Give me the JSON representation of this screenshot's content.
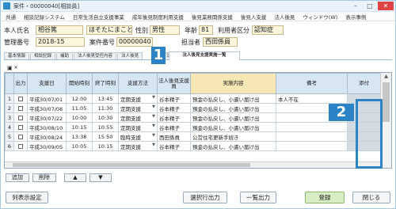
{
  "window": {
    "title": "案件・00000040[相談員]"
  },
  "menu": [
    "共通",
    "相談記録システム",
    "日常生活自立支援事業",
    "成年後見制度利用支援",
    "後見業務関係支援",
    "後見人支援",
    "法人後見",
    "ウィンドウ(W)",
    "表示事例"
  ],
  "info": {
    "name_label": "本人氏名",
    "name_value": "相谷篤",
    "kana_value": "ほそたにまこと",
    "sex_label": "性別",
    "sex_value": "男性",
    "age_label": "年齢",
    "age_value": "81",
    "category_label": "利用者区分",
    "category_value": "認知症",
    "mgmt_label": "管理番号",
    "mgmt_value": "2018-15",
    "case_label": "案件番号",
    "case_value": "00000040",
    "person_label": "担当者",
    "person_value": "西田係員"
  },
  "tabs": [
    "基本情報",
    "相談記録",
    "補助",
    "法人後見受任内容",
    "法人後見",
    "法人後見支援実施一覧"
  ],
  "markers": {
    "m1": "1",
    "m2": "2"
  },
  "toolbar": {
    "icon1": "▣",
    "icon2": "✕"
  },
  "table": {
    "headers": [
      "出力",
      "支援日",
      "開始時刻",
      "終了時刻",
      "支援方法",
      "法人後見支援員",
      "実施内容",
      "備考",
      "添付"
    ],
    "rows": [
      {
        "no": "1",
        "date": "平成30/07/01",
        "start": "12:00",
        "end": "13:45",
        "method": "定期支援",
        "staff": "谷本精子",
        "content": "預金の払戻し、小遣い届け出",
        "note": "本人不在"
      },
      {
        "no": "2",
        "date": "平成30/07/08",
        "start": "11:05",
        "end": "11:30",
        "method": "定期支援",
        "staff": "谷本精子",
        "content": "預金の払戻し、小遣い届け出",
        "note": ""
      },
      {
        "no": "3",
        "date": "平成30/07/22",
        "start": "10:00",
        "end": "10:30",
        "method": "定期支援",
        "staff": "谷本精子",
        "content": "預金の払戻し、小遣い届け出",
        "note": ""
      },
      {
        "no": "4",
        "date": "平成30/08/10",
        "start": "10:15",
        "end": "10:55",
        "method": "定期支援",
        "staff": "谷本精子",
        "content": "預金の払戻し、小遣い届け出",
        "note": ""
      },
      {
        "no": "5",
        "date": "平成30/08/24",
        "start": "13:38",
        "end": "15:50",
        "method": "臨時支援",
        "staff": "西田係員",
        "content": "公営住宅更新手続き",
        "note": ""
      },
      {
        "no": "6",
        "date": "平成30/09/05",
        "start": "10:05",
        "end": "10:15",
        "method": "定期支援",
        "staff": "谷本精子",
        "content": "預金の払戻し、小遣い届け出",
        "note": ""
      }
    ]
  },
  "row_buttons": {
    "add": "追加",
    "delete": "削除",
    "up": "▲",
    "down": "▼"
  },
  "footer": {
    "column_settings": "列表示設定",
    "selected_output": "選択行出力",
    "list_output": "一覧出力",
    "register": "登録",
    "close": "閉じる"
  }
}
